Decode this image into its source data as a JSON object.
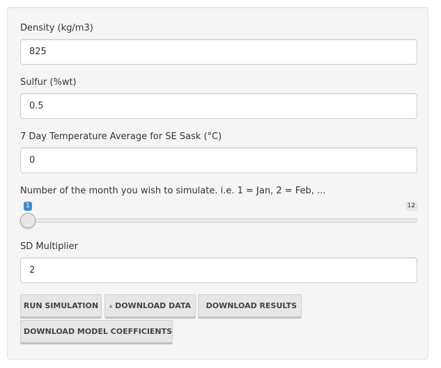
{
  "fields": {
    "density": {
      "label": "Density (kg/m3)",
      "value": "825"
    },
    "sulfur": {
      "label": "Sulfur (%wt)",
      "value": "0.5"
    },
    "temperature": {
      "label": "7 Day Temperature Average for SE Sask (°C)",
      "value": "0"
    },
    "month": {
      "label": "Number of the month you wish to simulate. i.e. 1 = Jan, 2 = Feb, ...",
      "min": "1",
      "max": "12",
      "value": 1
    },
    "sd_multiplier": {
      "label": "SD Multiplier",
      "value": "2"
    }
  },
  "buttons": {
    "run": "RUN SIMULATION",
    "download_data": "DOWNLOAD DATA",
    "download_results": "DOWNLOAD RESULTS",
    "download_coefficients": "DOWNLOAD MODEL COEFFICIENTS"
  },
  "icons": {
    "download": "download-icon"
  },
  "colors": {
    "slider_value_badge": "#428bca",
    "panel_background": "#f5f5f5",
    "button_background": "#e6e6e6"
  }
}
